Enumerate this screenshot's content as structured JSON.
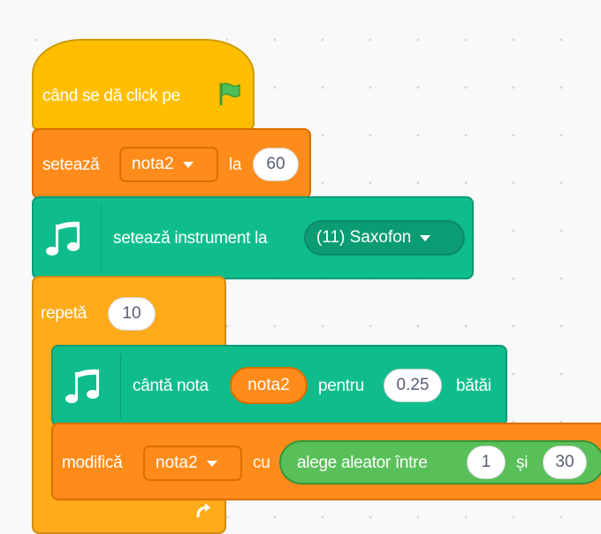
{
  "script": {
    "hat": {
      "label": "când se dă click pe",
      "icon": "green-flag-icon"
    },
    "set_var": {
      "label": "setează",
      "variable": "nota2",
      "to_label": "la",
      "value": "60"
    },
    "set_instrument": {
      "icon": "music-icon",
      "label": "setează instrument la",
      "instrument": "(11) Saxofon"
    },
    "repeat": {
      "label": "repetă",
      "times": "10",
      "end_icon": "repeat-arrow-icon"
    },
    "play_note": {
      "icon": "music-icon",
      "label": "cântă nota",
      "note_var": "nota2",
      "for_label": "pentru",
      "beats": "0.25",
      "beats_label": "bătăi"
    },
    "change_var": {
      "label": "modifică",
      "variable": "nota2",
      "by_label": "cu"
    },
    "random": {
      "label": "alege aleator între",
      "from": "1",
      "and_label": "și",
      "to": "30"
    }
  },
  "colors": {
    "events": "#ffbf00",
    "variables": "#ff8c1a",
    "music": "#0fbd8c",
    "control": "#ffab19",
    "operators": "#59c059"
  }
}
